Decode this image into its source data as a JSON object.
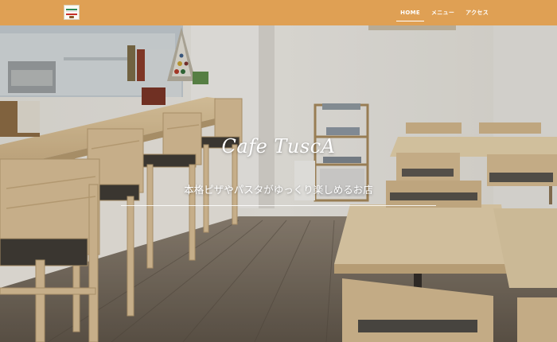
{
  "header": {
    "logo_icon": "cafe-logo-icon",
    "bar_color": "#dfa054",
    "nav": [
      {
        "label": "HOME",
        "active": true
      },
      {
        "label": "メニュー",
        "active": false
      },
      {
        "label": "アクセス",
        "active": false
      }
    ]
  },
  "hero": {
    "title": "Cafe TuscA",
    "subtitle": "本格ピザやパスタがゆっくり楽しめるお店"
  }
}
